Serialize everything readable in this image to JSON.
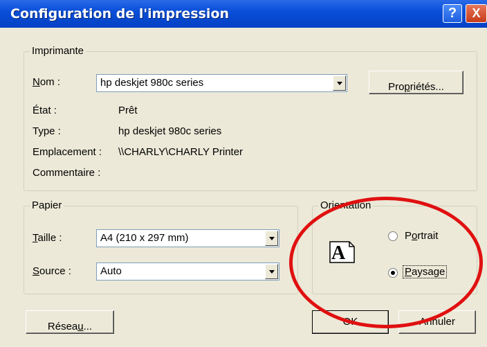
{
  "window": {
    "title": "Configuration de l'impression",
    "help_btn": "?",
    "close_btn": "X"
  },
  "printer": {
    "legend": "Imprimante",
    "name_label_u": "N",
    "name_label_rest": "om :",
    "name_value": "hp deskjet 980c series",
    "properties_pre": "Pro",
    "properties_u": "p",
    "properties_post": "riétés...",
    "state_label": "État :",
    "state_value": "Prêt",
    "type_label": "Type :",
    "type_value": "hp deskjet 980c series",
    "location_label": "Emplacement :",
    "location_value": "\\\\CHARLY\\CHARLY Printer",
    "comment_label": "Commentaire :"
  },
  "paper": {
    "legend": "Papier",
    "size_label_u": "T",
    "size_label_rest": "aille :",
    "size_value": "A4 (210 x 297 mm)",
    "source_label_u": "S",
    "source_label_rest": "ource :",
    "source_value": "Auto"
  },
  "orientation": {
    "legend": "Orientation",
    "icon_letter": "A",
    "portrait_pre": "P",
    "portrait_u": "o",
    "portrait_post": "rtrait",
    "landscape_u": "P",
    "landscape_post": "aysage",
    "selected": "Paysage"
  },
  "buttons": {
    "network_pre": "Résea",
    "network_u": "u",
    "network_post": "...",
    "ok": "OK",
    "cancel": "Annuler"
  }
}
